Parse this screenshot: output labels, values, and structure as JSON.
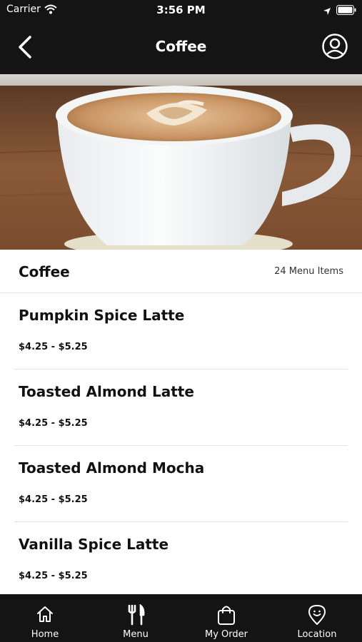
{
  "status_bar": {
    "carrier": "Carrier",
    "time": "3:56 PM"
  },
  "nav": {
    "title": "Coffee"
  },
  "section": {
    "title": "Coffee",
    "count": "24 Menu Items"
  },
  "items": [
    {
      "name": "Pumpkin Spice Latte",
      "price": "$4.25 - $5.25"
    },
    {
      "name": "Toasted Almond Latte",
      "price": "$4.25 - $5.25"
    },
    {
      "name": "Toasted Almond Mocha",
      "price": "$4.25 - $5.25"
    },
    {
      "name": "Vanilla Spice Latte",
      "price": "$4.25 - $5.25"
    }
  ],
  "tabs": [
    {
      "label": "Home",
      "icon": "home-icon"
    },
    {
      "label": "Menu",
      "icon": "fork-knife-icon"
    },
    {
      "label": "My Order",
      "icon": "shopping-bag-icon"
    },
    {
      "label": "Location",
      "icon": "location-pin-icon"
    }
  ],
  "colors": {
    "bar_background": "#141414",
    "text": "#111111",
    "divider": "#e4e4e4"
  }
}
